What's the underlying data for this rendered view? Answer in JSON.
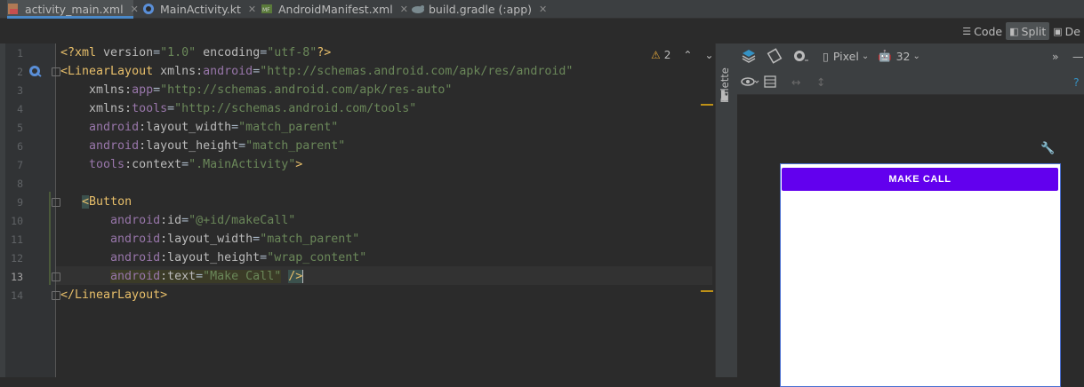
{
  "tabs": [
    {
      "label": "activity_main.xml",
      "icon": "xml-layout-icon",
      "active": true
    },
    {
      "label": "MainActivity.kt",
      "icon": "kotlin-file-icon",
      "active": false
    },
    {
      "label": "AndroidManifest.xml",
      "icon": "manifest-icon",
      "active": false
    },
    {
      "label": "build.gradle (:app)",
      "icon": "gradle-icon",
      "active": false
    }
  ],
  "view_toggles": {
    "code": "Code",
    "split": "Split",
    "design": "De"
  },
  "editor": {
    "warnings": "2",
    "line_numbers": [
      "1",
      "2",
      "3",
      "4",
      "5",
      "6",
      "7",
      "8",
      "9",
      "10",
      "11",
      "12",
      "13",
      "14"
    ]
  },
  "palette_label": "Palette",
  "design_toolbar": {
    "device": "Pixel",
    "api": "32"
  },
  "preview": {
    "button_text": "MAKE CALL"
  },
  "colors": {
    "accent": "#4a88c7",
    "button": "#6200ee",
    "tag": "#e8bf6a",
    "string": "#6a8759",
    "namespace": "#9876aa"
  }
}
